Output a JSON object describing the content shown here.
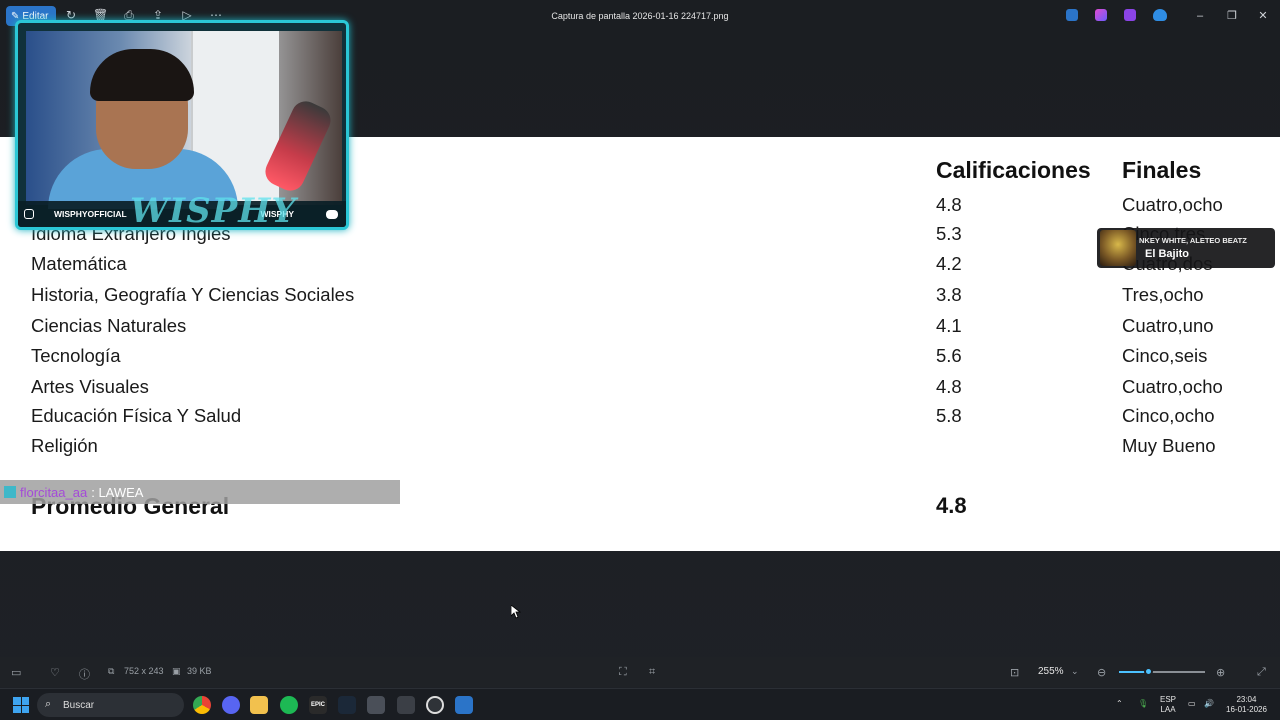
{
  "window": {
    "title": "Captura de pantalla 2026-01-16 224717.png",
    "edit_label": "Editar"
  },
  "document": {
    "headers": {
      "grades": "Calificaciones",
      "finals": "Finales"
    },
    "rows": [
      {
        "subject": "",
        "grade": "4.8",
        "word": "Cuatro,ocho"
      },
      {
        "subject": "Idioma Extranjero Inglés",
        "grade": "5.3",
        "word": "Cinco,tres"
      },
      {
        "subject": "Matemática",
        "grade": "4.2",
        "word": "Cuatro,dos"
      },
      {
        "subject": "Historia, Geografía Y Ciencias Sociales",
        "grade": "3.8",
        "word": "Tres,ocho"
      },
      {
        "subject": "Ciencias Naturales",
        "grade": "4.1",
        "word": "Cuatro,uno"
      },
      {
        "subject": "Tecnología",
        "grade": "5.6",
        "word": "Cinco,seis"
      },
      {
        "subject": "Artes Visuales",
        "grade": "4.8",
        "word": "Cuatro,ocho"
      },
      {
        "subject": "Educación Física Y Salud",
        "grade": "5.8",
        "word": "Cinco,ocho"
      },
      {
        "subject": "Religión",
        "grade": "",
        "word": "Muy Bueno"
      }
    ],
    "average_label": "Promedio General",
    "average_value": "4.8"
  },
  "stream": {
    "left_handle": "WISPHYOFFICIAL",
    "right_handle": "WISPHY",
    "brand": "WISPHY",
    "music_artist": "NKEY WHITE, ALETEO BEATZ",
    "music_title": "El Bajito",
    "chat_user": "florcitaa_aa",
    "chat_message": ": LAWEA"
  },
  "statusbar": {
    "dimensions": "752 x 243",
    "size": "39 KB",
    "zoom": "255%",
    "zoom_level": 0.35
  },
  "taskbar": {
    "search_placeholder": "Buscar",
    "lang": "ESP",
    "region": "LAA",
    "time": "23:04",
    "date": "16-01-2026"
  }
}
